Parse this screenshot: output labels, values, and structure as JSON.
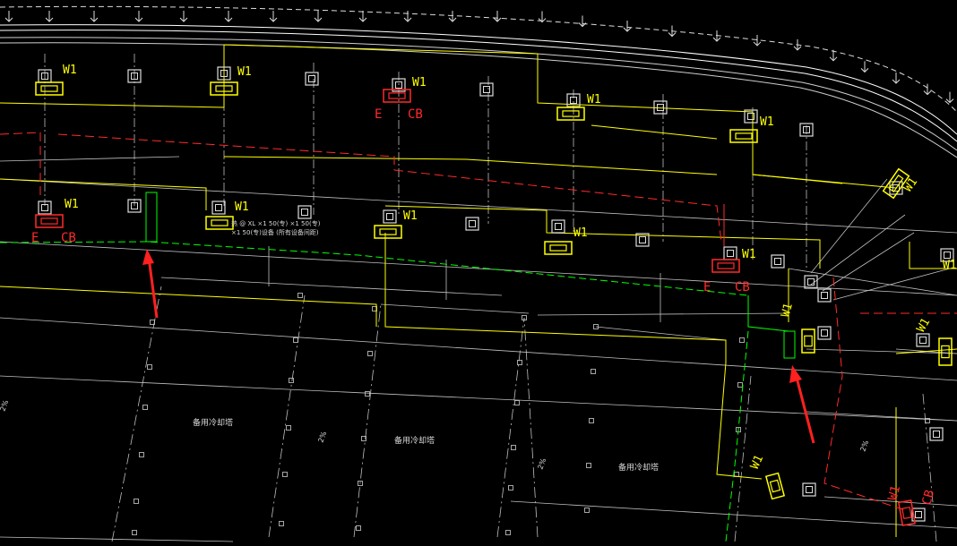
{
  "colors": {
    "background": "#000000",
    "wall": "#ffffff",
    "grid": "#bfbfbf",
    "equipment": "#ffff00",
    "electrical": "#ff2a2a",
    "drain": "#00ff00",
    "annotation_arrow": "#ff2020"
  },
  "labels": {
    "w1": "W1",
    "e": "E",
    "cb": "CB",
    "note_line1": "热 @ XL ×1 50(专) ×1 50(专)",
    "note_line2": "×1 50(专)设备 (所有设备间距)",
    "room_spare": "备用冷却塔",
    "slope": "2%"
  },
  "icons": [
    "red-arrow-icon",
    "red-arrow-icon"
  ]
}
